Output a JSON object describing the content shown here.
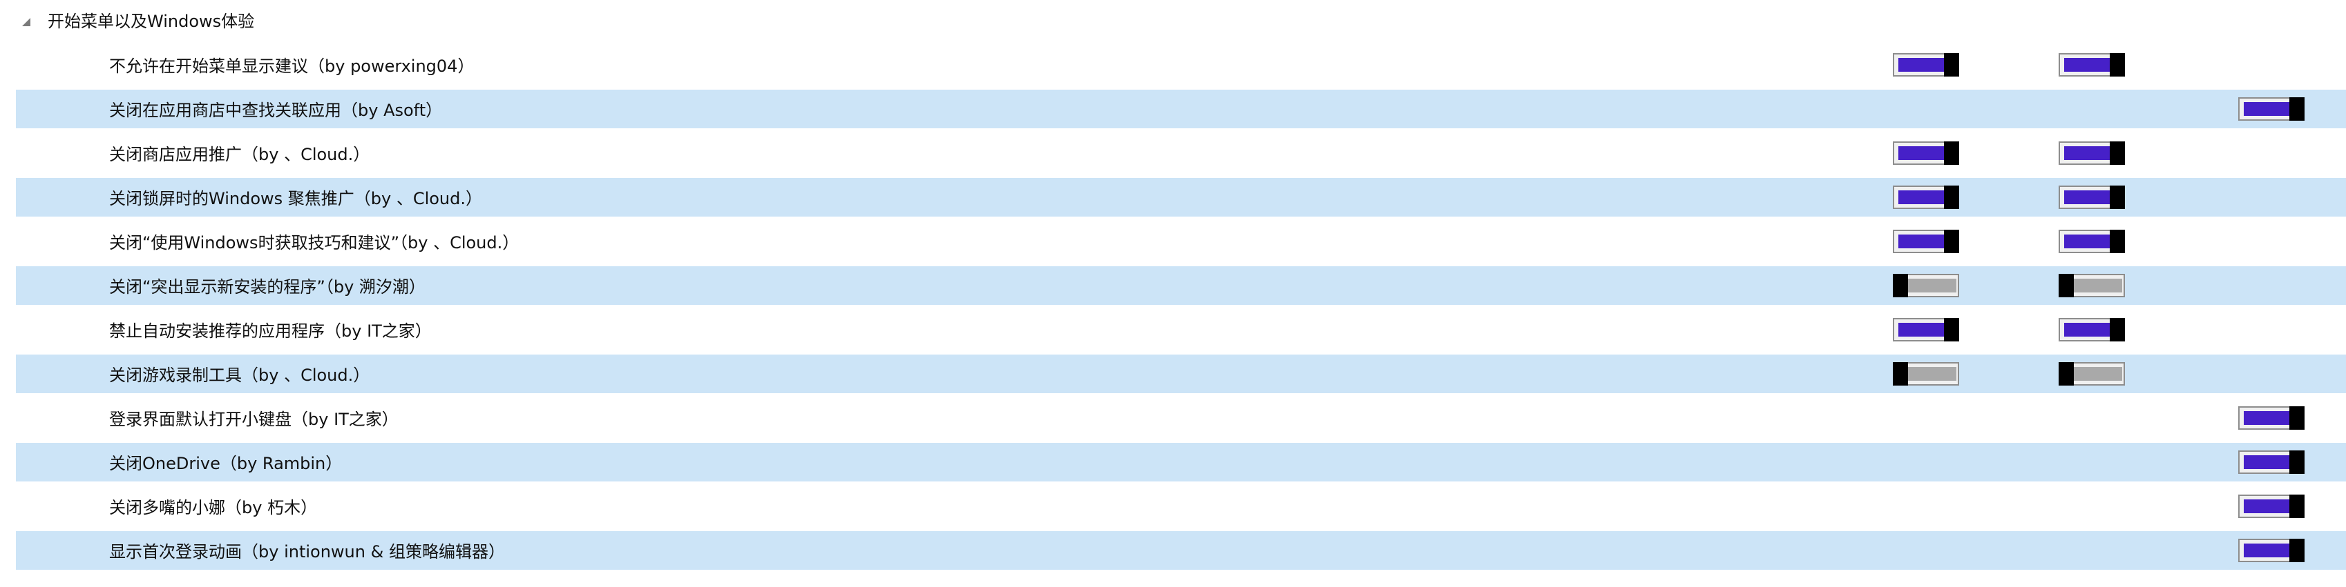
{
  "group": {
    "title": "开始菜单以及Windows体验",
    "expanded": true
  },
  "colors": {
    "row_alt_background": "#cce4f7",
    "toggle_on_fill": "#4620c8",
    "toggle_off_fill": "#a9a9a9",
    "toggle_knob": "#000000"
  },
  "rows": [
    {
      "label": "不允许在开始菜单显示建议（by powerxing04）",
      "toggles": {
        "col1": "on",
        "col2": "on",
        "col3": null
      }
    },
    {
      "label": "关闭在应用商店中查找关联应用（by Asoft）",
      "toggles": {
        "col1": null,
        "col2": null,
        "col3": "on"
      }
    },
    {
      "label": "关闭商店应用推广（by 、Cloud.）",
      "toggles": {
        "col1": "on",
        "col2": "on",
        "col3": null
      }
    },
    {
      "label": "关闭锁屏时的Windows 聚焦推广（by 、Cloud.）",
      "toggles": {
        "col1": "on",
        "col2": "on",
        "col3": null
      }
    },
    {
      "label": "关闭“使用Windows时获取技巧和建议”（by 、Cloud.）",
      "toggles": {
        "col1": "on",
        "col2": "on",
        "col3": null
      }
    },
    {
      "label": "关闭“突出显示新安装的程序”（by 溯汐潮）",
      "toggles": {
        "col1": "off",
        "col2": "off",
        "col3": null
      }
    },
    {
      "label": "禁止自动安装推荐的应用程序（by IT之家）",
      "toggles": {
        "col1": "on",
        "col2": "on",
        "col3": null
      }
    },
    {
      "label": "关闭游戏录制工具（by 、Cloud.）",
      "toggles": {
        "col1": "off",
        "col2": "off",
        "col3": null
      }
    },
    {
      "label": "登录界面默认打开小键盘（by IT之家）",
      "toggles": {
        "col1": null,
        "col2": null,
        "col3": "on"
      }
    },
    {
      "label": "关闭OneDrive（by Rambin）",
      "toggles": {
        "col1": null,
        "col2": null,
        "col3": "on"
      }
    },
    {
      "label": "关闭多嘴的小娜（by 朽木）",
      "toggles": {
        "col1": null,
        "col2": null,
        "col3": "on"
      }
    },
    {
      "label": "显示首次登录动画（by intionwun & 组策略编辑器）",
      "toggles": {
        "col1": null,
        "col2": null,
        "col3": "on"
      }
    }
  ]
}
